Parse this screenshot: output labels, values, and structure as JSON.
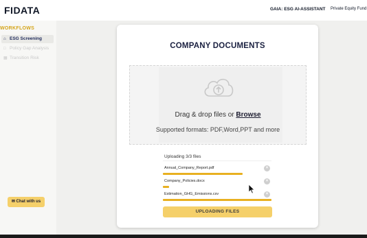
{
  "header": {
    "logo": "FIDATA",
    "app_name": "GAIA: ESG AI-ASSISTANT",
    "fund_link": "Private Equity Fund"
  },
  "sidebar": {
    "heading": "WORKFLOWS",
    "items": [
      {
        "label": "ESG Screening",
        "icon": "home-icon",
        "active": true
      },
      {
        "label": "Policy Gap Analysis",
        "icon": "document-icon",
        "active": false
      },
      {
        "label": "Transition Risk",
        "icon": "calculator-icon",
        "active": false
      }
    ],
    "chat_button": "Chat with us"
  },
  "card": {
    "title": "COMPANY DOCUMENTS",
    "dropzone": {
      "prompt": "Drag & drop files or ",
      "browse": "Browse",
      "formats": "Supported formats: PDF,Word,PPT and more"
    },
    "upload_status": "Uploading 3/3 files",
    "files": [
      {
        "name": "Annual_Company_Report.pdf",
        "progress": 0.88
      },
      {
        "name": "Company_Policies.docx",
        "progress": 0.06
      },
      {
        "name": "Estimation_GHG_Emissions.csv",
        "progress": 0.99
      }
    ],
    "button_label": "UPLOADING FILES"
  },
  "colors": {
    "accent": "#f5d06a",
    "progress": "#e8b020",
    "heading_gold": "#d4a418",
    "title_navy": "#1a2040"
  }
}
